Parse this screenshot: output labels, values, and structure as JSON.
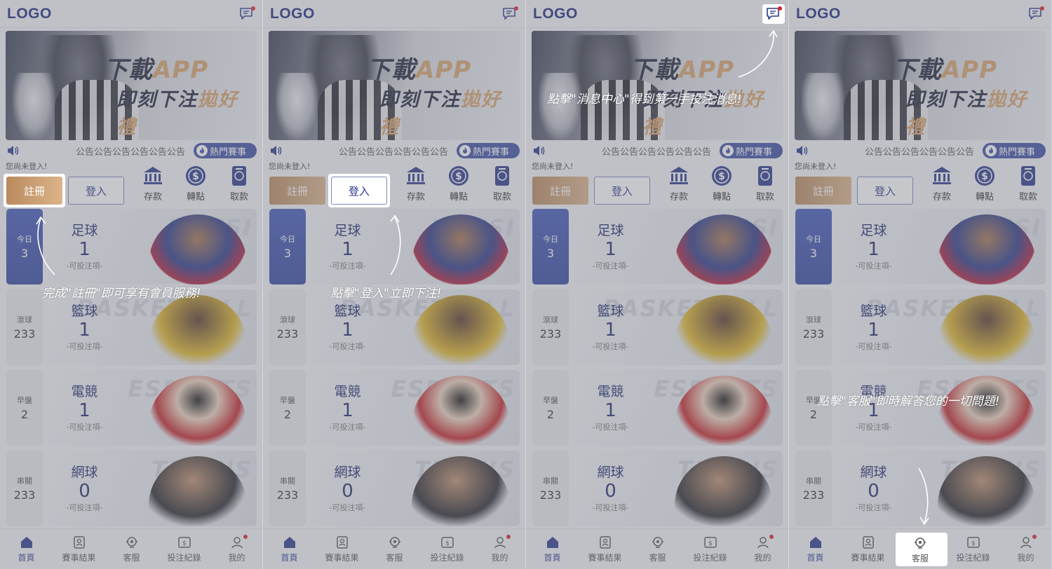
{
  "app": {
    "logo": "LOGO",
    "notice_text": "公告公告公告公告公告公告",
    "hot_events": "熱門賽事",
    "not_logged_in": "您尚未登入!",
    "register": "註冊",
    "login": "登入",
    "quick_actions": [
      {
        "label": "存款",
        "icon": "bank-icon"
      },
      {
        "label": "轉點",
        "icon": "dollar-coin-icon"
      },
      {
        "label": "取款",
        "icon": "withdraw-card-icon"
      }
    ],
    "banner": {
      "line1_a": "下載",
      "line1_b": "APP",
      "line2_a": "即刻下注",
      "line2_b": "拋好禮"
    },
    "side_cards": [
      {
        "label": "今日",
        "count": "3"
      },
      {
        "label": "滾球",
        "count": "233"
      },
      {
        "label": "早盤",
        "count": "2"
      },
      {
        "label": "串關",
        "count": "233"
      }
    ],
    "sports": [
      {
        "name": "足球",
        "count": "1",
        "sub": "-可投注項-",
        "bgword": "MESSI"
      },
      {
        "name": "籃球",
        "count": "1",
        "sub": "-可投注項-",
        "bgword": "BASKETBALL"
      },
      {
        "name": "電競",
        "count": "1",
        "sub": "-可投注項-",
        "bgword": "ESPORTS"
      },
      {
        "name": "網球",
        "count": "0",
        "sub": "-可投注項-",
        "bgword": "TENNIS"
      }
    ],
    "tabs": [
      {
        "label": "首頁",
        "icon": "home-icon"
      },
      {
        "label": "賽事結果",
        "icon": "results-icon"
      },
      {
        "label": "客服",
        "icon": "support-icon"
      },
      {
        "label": "投注紀錄",
        "icon": "bet-record-icon"
      },
      {
        "label": "我的",
        "icon": "profile-icon"
      }
    ]
  },
  "hints": [
    "完成\"註冊\"即可享有會員服務!",
    "點擊\"登入\"立即下注!",
    "點擊\"消息中心\"得到第一手投注消息!",
    "點擊\"客服\"即時解答您的一切問題!"
  ],
  "colors": {
    "brand": "#1c2a7c",
    "accent_gold": "#d7a36b",
    "active_blue": "#3d4ea4",
    "alert_red": "#e0202a"
  }
}
